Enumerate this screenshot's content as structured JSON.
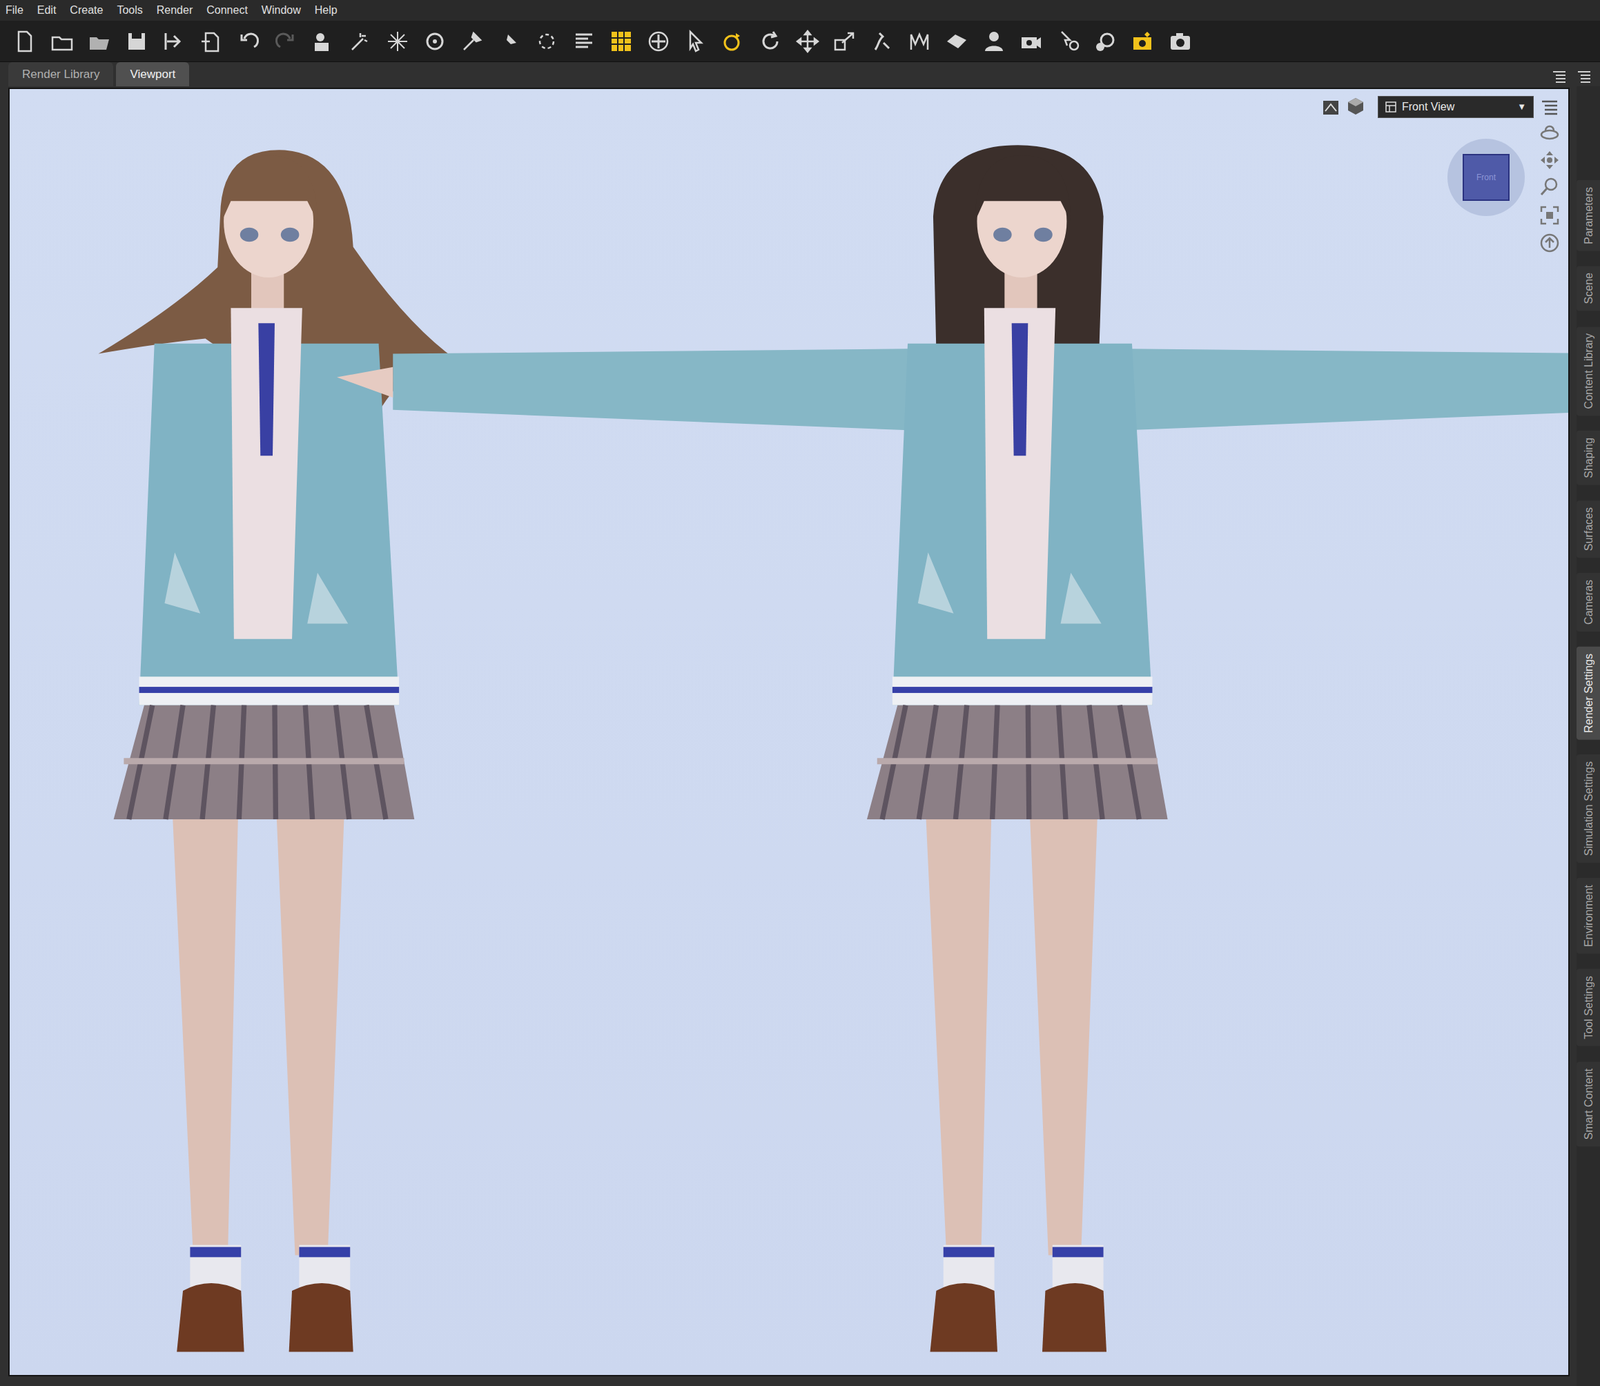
{
  "menu": [
    "File",
    "Edit",
    "Create",
    "Tools",
    "Render",
    "Connect",
    "Window",
    "Help"
  ],
  "toolbar": [
    {
      "active": false,
      "disabled": false
    },
    {
      "active": false,
      "disabled": false
    },
    {
      "active": false,
      "disabled": false
    },
    {
      "active": false,
      "disabled": false
    },
    {
      "active": false,
      "disabled": false
    },
    {
      "active": false,
      "disabled": false
    },
    {
      "active": false,
      "disabled": false
    },
    {
      "active": false,
      "disabled": true
    },
    {
      "active": false,
      "disabled": false
    },
    {
      "active": false,
      "disabled": false
    },
    {
      "active": false,
      "disabled": false
    },
    {
      "active": false,
      "disabled": false
    },
    {
      "active": false,
      "disabled": false
    },
    {
      "active": false,
      "disabled": false
    },
    {
      "active": false,
      "disabled": false
    },
    {
      "active": false,
      "disabled": false
    },
    {
      "active": true,
      "disabled": false
    },
    {
      "active": false,
      "disabled": false
    },
    {
      "active": false,
      "disabled": false
    },
    {
      "active": true,
      "disabled": false
    },
    {
      "active": false,
      "disabled": false
    },
    {
      "active": false,
      "disabled": false
    },
    {
      "active": false,
      "disabled": false
    },
    {
      "active": false,
      "disabled": false
    },
    {
      "active": false,
      "disabled": false
    },
    {
      "active": false,
      "disabled": false
    },
    {
      "active": false,
      "disabled": false
    },
    {
      "active": false,
      "disabled": false
    },
    {
      "active": false,
      "disabled": false
    },
    {
      "active": false,
      "disabled": false
    },
    {
      "active": true,
      "disabled": false
    },
    {
      "active": false,
      "disabled": false
    }
  ],
  "tabs": [
    {
      "label": "Render Library",
      "selected": false
    },
    {
      "label": "Viewport",
      "selected": true
    }
  ],
  "viewport": {
    "view_menu": {
      "label": "Front View",
      "arrow": "▼"
    },
    "nav_cube_label": "Front"
  },
  "side_tabs": [
    {
      "label": "Parameters",
      "selected": false
    },
    {
      "label": "Scene",
      "selected": false
    },
    {
      "label": "Content Library",
      "selected": false
    },
    {
      "label": "Shaping",
      "selected": false
    },
    {
      "label": "Surfaces",
      "selected": false
    },
    {
      "label": "Cameras",
      "selected": false
    },
    {
      "label": "Render Settings",
      "selected": true
    },
    {
      "label": "Simulation Settings",
      "selected": false
    },
    {
      "label": "Environment",
      "selected": false
    },
    {
      "label": "Tool Settings",
      "selected": false
    },
    {
      "label": "Smart Content",
      "selected": false
    }
  ]
}
